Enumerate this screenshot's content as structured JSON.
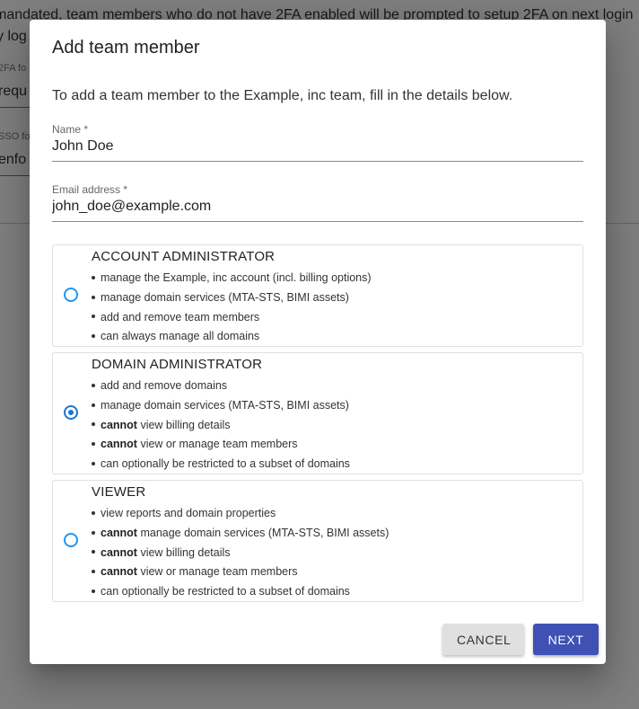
{
  "background": {
    "line1": "mandated, team members who do not have 2FA enabled will be prompted to setup 2FA on next login",
    "line2": "y log",
    "field1_label": "2FA fo",
    "field1_value": "requ",
    "field2_label": "SSO fo",
    "field2_value": "enfo"
  },
  "dialog": {
    "title": "Add team member",
    "intro": "To add a team member to the Example, inc team, fill in the details below.",
    "name_label": "Name *",
    "name_value": "John Doe",
    "email_label": "Email address *",
    "email_value": "john_doe@example.com",
    "roles": [
      {
        "title": "ACCOUNT ADMINISTRATOR",
        "checked": false,
        "bullets": [
          {
            "bold": "",
            "text": "manage the Example, inc account (incl. billing options)"
          },
          {
            "bold": "",
            "text": "manage domain services (MTA-STS, BIMI assets)"
          },
          {
            "bold": "",
            "text": "add and remove team members"
          },
          {
            "bold": "",
            "text": "can always manage all domains"
          }
        ]
      },
      {
        "title": "DOMAIN ADMINISTRATOR",
        "checked": true,
        "bullets": [
          {
            "bold": "",
            "text": "add and remove domains"
          },
          {
            "bold": "",
            "text": "manage domain services (MTA-STS, BIMI assets)"
          },
          {
            "bold": "cannot",
            "text": " view billing details"
          },
          {
            "bold": "cannot",
            "text": " view or manage team members"
          },
          {
            "bold": "",
            "text": "can optionally be restricted to a subset of domains"
          }
        ]
      },
      {
        "title": "VIEWER",
        "checked": false,
        "bullets": [
          {
            "bold": "",
            "text": "view reports and domain properties"
          },
          {
            "bold": "cannot",
            "text": " manage domain services (MTA-STS, BIMI assets)"
          },
          {
            "bold": "cannot",
            "text": " view billing details"
          },
          {
            "bold": "cannot",
            "text": " view or manage team members"
          },
          {
            "bold": "",
            "text": "can optionally be restricted to a subset of domains"
          }
        ]
      }
    ],
    "cancel_label": "CANCEL",
    "next_label": "NEXT"
  },
  "colors": {
    "primary": "#3f51b5",
    "radio": "#2196f3"
  }
}
